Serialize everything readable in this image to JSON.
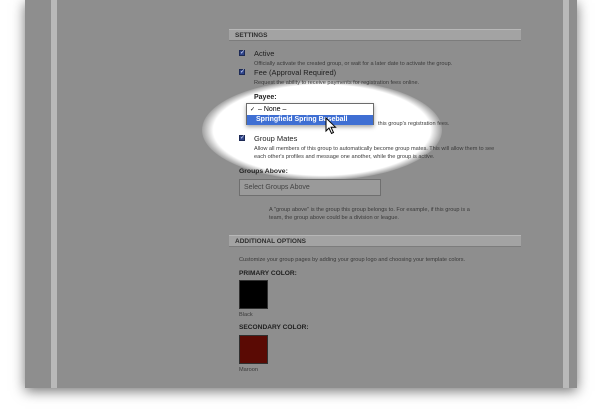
{
  "settings": {
    "header": "SETTINGS",
    "active": {
      "label": "Active",
      "checked": true,
      "description": "Officially activate the created group, or wait for a later date to activate the group."
    },
    "fee": {
      "label": "Fee (Approval Required)",
      "checked": true,
      "description": "Request the ability to receive payments for registration fees online."
    },
    "payee": {
      "label": "Payee:",
      "options": [
        "– None –",
        "Springfield Spring Baseball"
      ],
      "selected": "– None –",
      "highlighted": "Springfield Spring Baseball",
      "partial_description": "this group's registration fees."
    },
    "group_mates": {
      "label": "Group Mates",
      "checked": true,
      "description_line1": "Allow all members of this group to automatically become group mates. This will allow them to see",
      "description_line2": "each other's profiles and message one another, while the group is active."
    },
    "groups_above": {
      "label": "Groups Above:",
      "placeholder": "Select Groups Above",
      "help_line1": "A \"group above\" is the group this group belongs to. For example, if this group is a",
      "help_line2": "team, the group above could be a division or league."
    }
  },
  "additional_options": {
    "header": "ADDITIONAL OPTIONS",
    "intro": "Customize your group pages by adding your group logo and choosing your template colors.",
    "primary_color": {
      "label": "PRIMARY COLOR:",
      "name": "Black",
      "hex": "#000000"
    },
    "secondary_color": {
      "label": "SECONDARY COLOR:",
      "name": "Maroon",
      "hex": "#5a0a04"
    }
  },
  "icons": {
    "checkbox": "checkbox-checked-icon",
    "menu_check": "checkmark-icon",
    "cursor": "arrow-cursor-icon"
  }
}
